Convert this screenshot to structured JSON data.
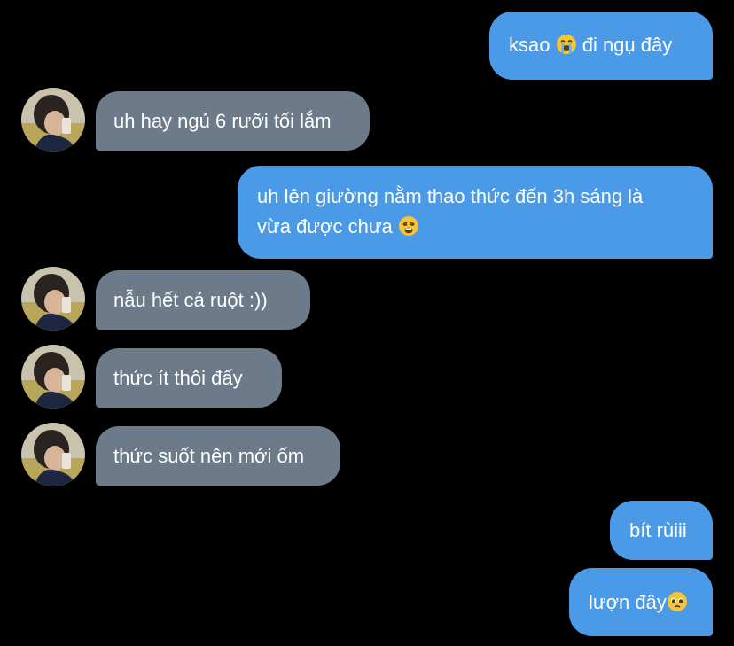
{
  "colors": {
    "background": "#000000",
    "outgoing_bubble": "#4a9ae8",
    "incoming_bubble": "#6c7a89",
    "text": "#ffffff"
  },
  "messages": [
    {
      "direction": "outgoing",
      "text_before": "ksao ",
      "emoji": "loudly-crying-face-emoji",
      "text_after": " đi ngụ đây"
    },
    {
      "direction": "incoming",
      "text": "uh hay ngủ 6 rưỡi tối lắm"
    },
    {
      "direction": "outgoing",
      "line1": "uh lên giường nằm thao thức đến 3h sáng là",
      "line2": "vừa được chưa ",
      "emoji": "weary-face-emoji"
    },
    {
      "direction": "incoming",
      "text": "nẫu hết cả ruột :))"
    },
    {
      "direction": "incoming",
      "text": "thức ít thôi đấy"
    },
    {
      "direction": "incoming",
      "text": "thức suốt nên mới ốm"
    },
    {
      "direction": "outgoing",
      "text": "bít rùiii"
    },
    {
      "direction": "outgoing",
      "text": "lượn đây",
      "emoji": "pleading-face-emoji"
    }
  ]
}
